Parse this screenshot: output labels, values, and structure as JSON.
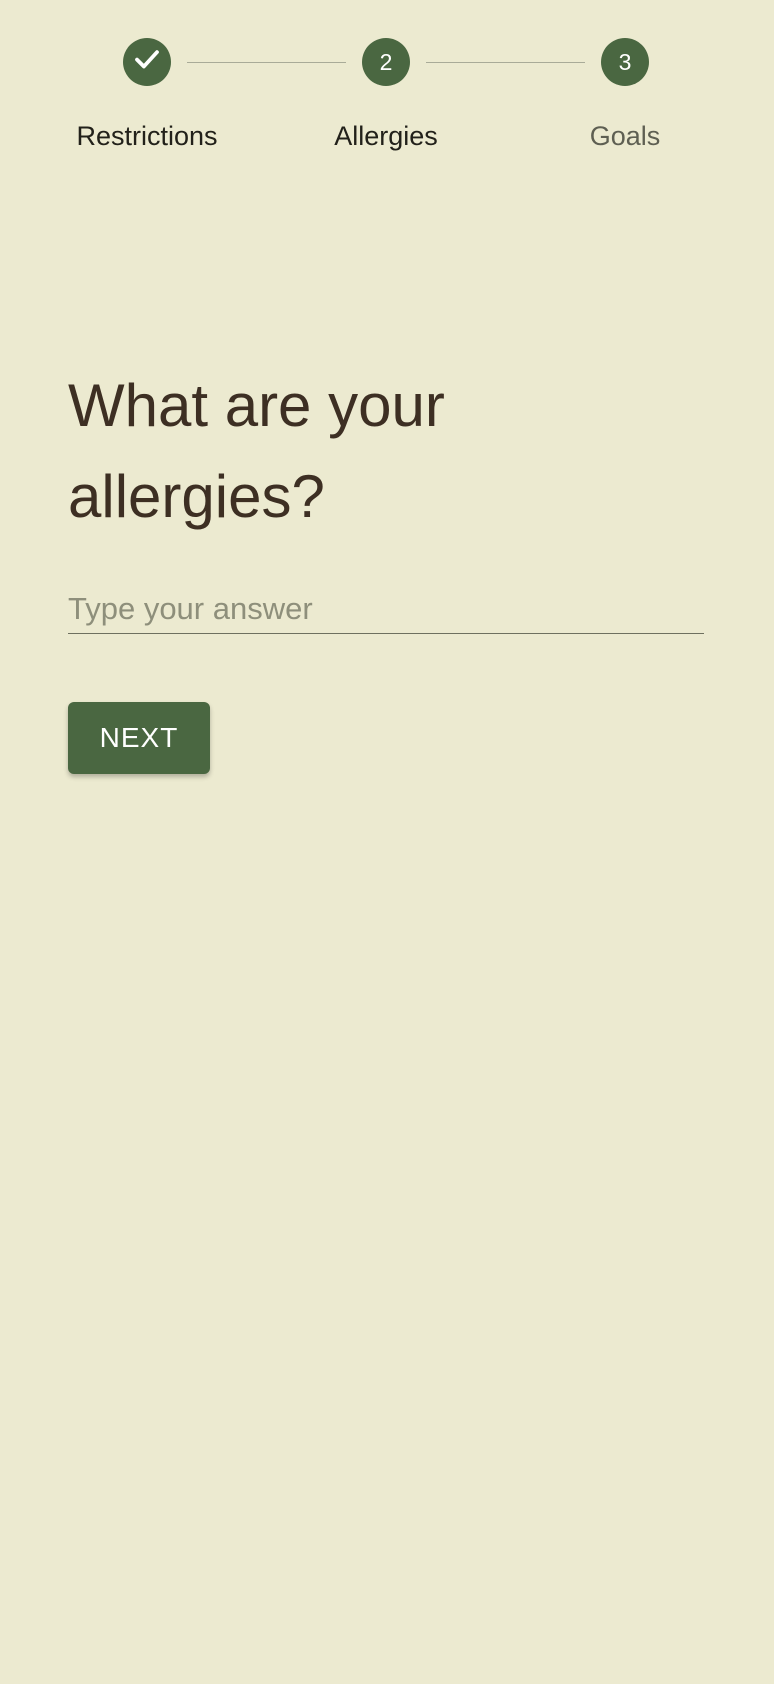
{
  "stepper": {
    "steps": [
      {
        "label": "Restrictions",
        "state": "completed",
        "icon": "check-icon"
      },
      {
        "label": "Allergies",
        "number": "2",
        "state": "active"
      },
      {
        "label": "Goals",
        "number": "3",
        "state": "upcoming"
      }
    ]
  },
  "question": {
    "title": "What are your allergies?"
  },
  "answer": {
    "value": "",
    "placeholder": "Type your answer"
  },
  "actions": {
    "next_label": "NEXT"
  },
  "colors": {
    "background": "#ecead0",
    "accent": "#4a6741",
    "title_text": "#3d2f23"
  }
}
